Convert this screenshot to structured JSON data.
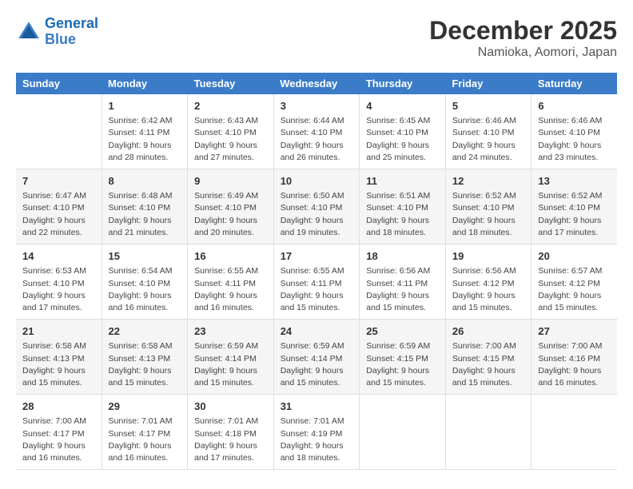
{
  "logo": {
    "line1": "General",
    "line2": "Blue"
  },
  "title": "December 2025",
  "subtitle": "Namioka, Aomori, Japan",
  "days_of_week": [
    "Sunday",
    "Monday",
    "Tuesday",
    "Wednesday",
    "Thursday",
    "Friday",
    "Saturday"
  ],
  "weeks": [
    [
      {
        "day": "",
        "content": ""
      },
      {
        "day": "1",
        "content": "Sunrise: 6:42 AM\nSunset: 4:11 PM\nDaylight: 9 hours\nand 28 minutes."
      },
      {
        "day": "2",
        "content": "Sunrise: 6:43 AM\nSunset: 4:10 PM\nDaylight: 9 hours\nand 27 minutes."
      },
      {
        "day": "3",
        "content": "Sunrise: 6:44 AM\nSunset: 4:10 PM\nDaylight: 9 hours\nand 26 minutes."
      },
      {
        "day": "4",
        "content": "Sunrise: 6:45 AM\nSunset: 4:10 PM\nDaylight: 9 hours\nand 25 minutes."
      },
      {
        "day": "5",
        "content": "Sunrise: 6:46 AM\nSunset: 4:10 PM\nDaylight: 9 hours\nand 24 minutes."
      },
      {
        "day": "6",
        "content": "Sunrise: 6:46 AM\nSunset: 4:10 PM\nDaylight: 9 hours\nand 23 minutes."
      }
    ],
    [
      {
        "day": "7",
        "content": "Sunrise: 6:47 AM\nSunset: 4:10 PM\nDaylight: 9 hours\nand 22 minutes."
      },
      {
        "day": "8",
        "content": "Sunrise: 6:48 AM\nSunset: 4:10 PM\nDaylight: 9 hours\nand 21 minutes."
      },
      {
        "day": "9",
        "content": "Sunrise: 6:49 AM\nSunset: 4:10 PM\nDaylight: 9 hours\nand 20 minutes."
      },
      {
        "day": "10",
        "content": "Sunrise: 6:50 AM\nSunset: 4:10 PM\nDaylight: 9 hours\nand 19 minutes."
      },
      {
        "day": "11",
        "content": "Sunrise: 6:51 AM\nSunset: 4:10 PM\nDaylight: 9 hours\nand 18 minutes."
      },
      {
        "day": "12",
        "content": "Sunrise: 6:52 AM\nSunset: 4:10 PM\nDaylight: 9 hours\nand 18 minutes."
      },
      {
        "day": "13",
        "content": "Sunrise: 6:52 AM\nSunset: 4:10 PM\nDaylight: 9 hours\nand 17 minutes."
      }
    ],
    [
      {
        "day": "14",
        "content": "Sunrise: 6:53 AM\nSunset: 4:10 PM\nDaylight: 9 hours\nand 17 minutes."
      },
      {
        "day": "15",
        "content": "Sunrise: 6:54 AM\nSunset: 4:10 PM\nDaylight: 9 hours\nand 16 minutes."
      },
      {
        "day": "16",
        "content": "Sunrise: 6:55 AM\nSunset: 4:11 PM\nDaylight: 9 hours\nand 16 minutes."
      },
      {
        "day": "17",
        "content": "Sunrise: 6:55 AM\nSunset: 4:11 PM\nDaylight: 9 hours\nand 15 minutes."
      },
      {
        "day": "18",
        "content": "Sunrise: 6:56 AM\nSunset: 4:11 PM\nDaylight: 9 hours\nand 15 minutes."
      },
      {
        "day": "19",
        "content": "Sunrise: 6:56 AM\nSunset: 4:12 PM\nDaylight: 9 hours\nand 15 minutes."
      },
      {
        "day": "20",
        "content": "Sunrise: 6:57 AM\nSunset: 4:12 PM\nDaylight: 9 hours\nand 15 minutes."
      }
    ],
    [
      {
        "day": "21",
        "content": "Sunrise: 6:58 AM\nSunset: 4:13 PM\nDaylight: 9 hours\nand 15 minutes."
      },
      {
        "day": "22",
        "content": "Sunrise: 6:58 AM\nSunset: 4:13 PM\nDaylight: 9 hours\nand 15 minutes."
      },
      {
        "day": "23",
        "content": "Sunrise: 6:59 AM\nSunset: 4:14 PM\nDaylight: 9 hours\nand 15 minutes."
      },
      {
        "day": "24",
        "content": "Sunrise: 6:59 AM\nSunset: 4:14 PM\nDaylight: 9 hours\nand 15 minutes."
      },
      {
        "day": "25",
        "content": "Sunrise: 6:59 AM\nSunset: 4:15 PM\nDaylight: 9 hours\nand 15 minutes."
      },
      {
        "day": "26",
        "content": "Sunrise: 7:00 AM\nSunset: 4:15 PM\nDaylight: 9 hours\nand 15 minutes."
      },
      {
        "day": "27",
        "content": "Sunrise: 7:00 AM\nSunset: 4:16 PM\nDaylight: 9 hours\nand 16 minutes."
      }
    ],
    [
      {
        "day": "28",
        "content": "Sunrise: 7:00 AM\nSunset: 4:17 PM\nDaylight: 9 hours\nand 16 minutes."
      },
      {
        "day": "29",
        "content": "Sunrise: 7:01 AM\nSunset: 4:17 PM\nDaylight: 9 hours\nand 16 minutes."
      },
      {
        "day": "30",
        "content": "Sunrise: 7:01 AM\nSunset: 4:18 PM\nDaylight: 9 hours\nand 17 minutes."
      },
      {
        "day": "31",
        "content": "Sunrise: 7:01 AM\nSunset: 4:19 PM\nDaylight: 9 hours\nand 18 minutes."
      },
      {
        "day": "",
        "content": ""
      },
      {
        "day": "",
        "content": ""
      },
      {
        "day": "",
        "content": ""
      }
    ]
  ]
}
